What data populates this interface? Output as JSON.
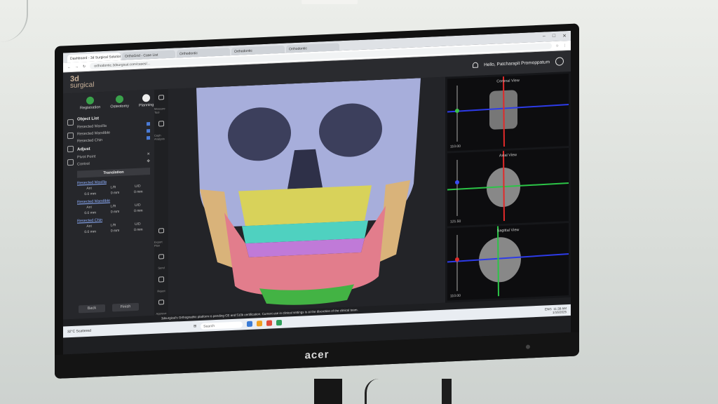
{
  "browser": {
    "tabs": [
      "Dashboard - 3d Surgical Solutions",
      "OrthoGrid - Case List",
      "Orthodontic",
      "Orthodontic",
      "Orthodontic"
    ],
    "url": "orthodontic.3dsurgical.com/cases/..."
  },
  "app": {
    "logo_top": "3d",
    "logo_bottom": "surgical",
    "greeting": "Hello, Patcharapit Promoppatum"
  },
  "steps": [
    "Registration",
    "Osteotomy",
    "Planning"
  ],
  "object_list": {
    "title": "Object List",
    "items": [
      "Resected Maxilla",
      "Resected Mandible",
      "Resected Chin"
    ]
  },
  "adjust": {
    "title": "Adjust",
    "pivot_point": "Pivot Point",
    "control": "Control",
    "translation": "Translation"
  },
  "groups": [
    {
      "name": "Resected Maxilla",
      "cols": [
        "Ant",
        "L/R",
        "U/D"
      ],
      "vals": [
        "0.0 mm",
        "0 mm",
        "0 mm"
      ]
    },
    {
      "name": "Resected Mandible",
      "cols": [
        "Ant",
        "L/R",
        "U/D"
      ],
      "vals": [
        "0.0 mm",
        "0 mm",
        "0 mm"
      ]
    },
    {
      "name": "Resected Chin",
      "cols": [
        "Ant",
        "L/R",
        "U/D"
      ],
      "vals": [
        "0.0 mm",
        "0 mm",
        "0 mm"
      ]
    }
  ],
  "buttons": {
    "back": "Back",
    "finish": "Finish"
  },
  "tools": [
    "Measure Tool",
    "Ceph Analysis",
    "Export Plan",
    "Send",
    "Reject",
    "Approve"
  ],
  "views": [
    {
      "label": "Coronal View",
      "value": "110.00"
    },
    {
      "label": "Axial View",
      "value": "121.50"
    },
    {
      "label": "Sagittal View",
      "value": "110.00"
    }
  ],
  "footer_note": "3dsurgical's Orthognathic platform is pending CE and 510k certification. Current use in clinical settings is at the discretion of the clinical team.",
  "taskbar": {
    "weather": "32°C Scattered",
    "search": "Search",
    "lang": "ENG",
    "time": "11:39 AM",
    "date": "1/16/2025"
  },
  "monitor_brand": "acer"
}
